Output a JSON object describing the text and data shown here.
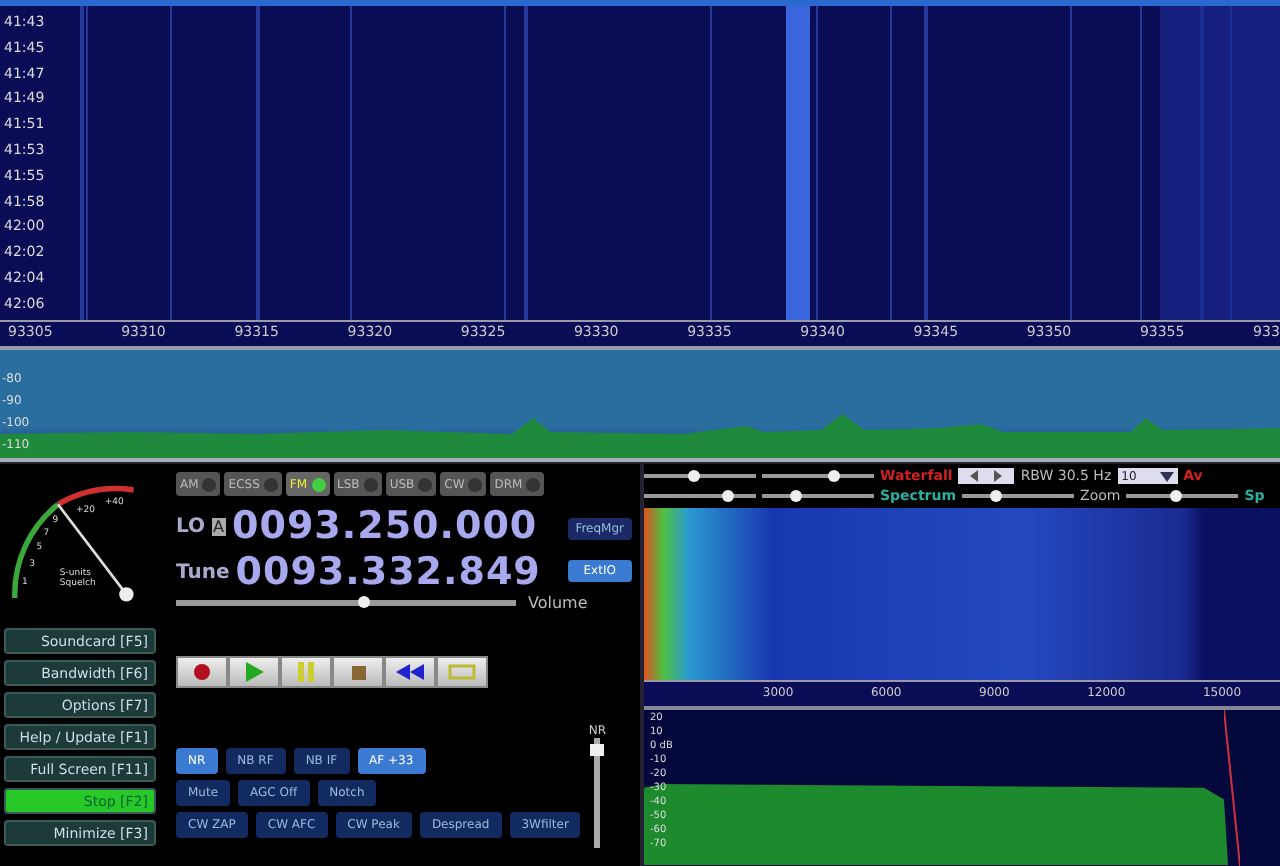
{
  "waterfall": {
    "times": [
      "41:43",
      "41:45",
      "41:47",
      "41:49",
      "41:51",
      "41:53",
      "41:55",
      "41:58",
      "42:00",
      "42:02",
      "42:04",
      "42:06"
    ]
  },
  "freq_axis": {
    "labels": [
      "93305",
      "93310",
      "93315",
      "93320",
      "93325",
      "93330",
      "93335",
      "93340",
      "93345",
      "93350",
      "93355",
      "933"
    ]
  },
  "spectrum": {
    "db_labels": [
      "-80",
      "-90",
      "-100",
      "-110"
    ]
  },
  "smeter": {
    "labels": [
      "1",
      "3",
      "5",
      "7",
      "9",
      "+20",
      "+40"
    ],
    "caption": [
      "S-units",
      "Squelch"
    ]
  },
  "modes": [
    {
      "label": "AM",
      "selected": false
    },
    {
      "label": "ECSS",
      "selected": false
    },
    {
      "label": "FM",
      "selected": true
    },
    {
      "label": "LSB",
      "selected": false
    },
    {
      "label": "USB",
      "selected": false
    },
    {
      "label": "CW",
      "selected": false
    },
    {
      "label": "DRM",
      "selected": false
    }
  ],
  "lo": {
    "label": "LO",
    "bank": "A",
    "value": "0093.250.000"
  },
  "tune": {
    "label": "Tune",
    "value": "0093.332.849"
  },
  "volume": {
    "label": "Volume",
    "level": 0.55
  },
  "side_buttons": [
    {
      "label": "FreqMgr",
      "selected": false
    },
    {
      "label": "ExtIO",
      "selected": true
    }
  ],
  "function_keys": [
    {
      "label": "Soundcard",
      "key": "[F5]",
      "selected": false
    },
    {
      "label": "Bandwidth",
      "key": "[F6]",
      "selected": false
    },
    {
      "label": "Options",
      "key": "[F7]",
      "selected": false
    },
    {
      "label": "Help / Update",
      "key": "[F1]",
      "selected": false
    },
    {
      "label": "Full Screen",
      "key": "[F11]",
      "selected": false
    },
    {
      "label": "Stop",
      "key": "[F2]",
      "selected": true
    },
    {
      "label": "Minimize",
      "key": "[F3]",
      "selected": false
    }
  ],
  "transport": [
    {
      "kind": "record"
    },
    {
      "kind": "play"
    },
    {
      "kind": "pause"
    },
    {
      "kind": "stop"
    },
    {
      "kind": "rewind"
    },
    {
      "kind": "loop"
    }
  ],
  "dsp_rows": [
    [
      {
        "label": "NR",
        "selected": true
      },
      {
        "label": "NB RF",
        "selected": false
      },
      {
        "label": "NB IF",
        "selected": false
      },
      {
        "label": "AF +33",
        "selected": true
      }
    ],
    [
      {
        "label": "Mute",
        "selected": false
      },
      {
        "label": "AGC Off",
        "selected": false
      },
      {
        "label": "Notch",
        "selected": false
      }
    ],
    [
      {
        "label": "CW ZAP",
        "selected": false
      },
      {
        "label": "CW AFC",
        "selected": false
      },
      {
        "label": "CW Peak",
        "selected": false
      },
      {
        "label": "Despread",
        "selected": false
      },
      {
        "label": "3Wfilter",
        "selected": false
      }
    ]
  ],
  "nr_slider": {
    "label": "NR",
    "level": 0.9
  },
  "audio_controls": {
    "row1_sliders": [
      {
        "level": 0.45
      },
      {
        "level": 0.65
      }
    ],
    "waterfall_label": "Waterfall",
    "rbw": "RBW 30.5 Hz",
    "average": "10",
    "average_label": "Av",
    "row2_sliders": [
      {
        "level": 0.75
      },
      {
        "level": 0.3
      }
    ],
    "spectrum_label": "Spectrum",
    "zoom_slider": {
      "level": 0.3
    },
    "zoom_label": "Zoom",
    "zoom2_slider": {
      "level": 0.45
    },
    "spectrum2_label": "Sp"
  },
  "audio_axis": {
    "labels": [
      "3000",
      "6000",
      "9000",
      "12000",
      "15000"
    ]
  },
  "audio_spectrum": {
    "db_labels": [
      "20",
      "10",
      "0 dB",
      "-10",
      "-20",
      "-30",
      "-40",
      "-50",
      "-60",
      "-70"
    ]
  }
}
